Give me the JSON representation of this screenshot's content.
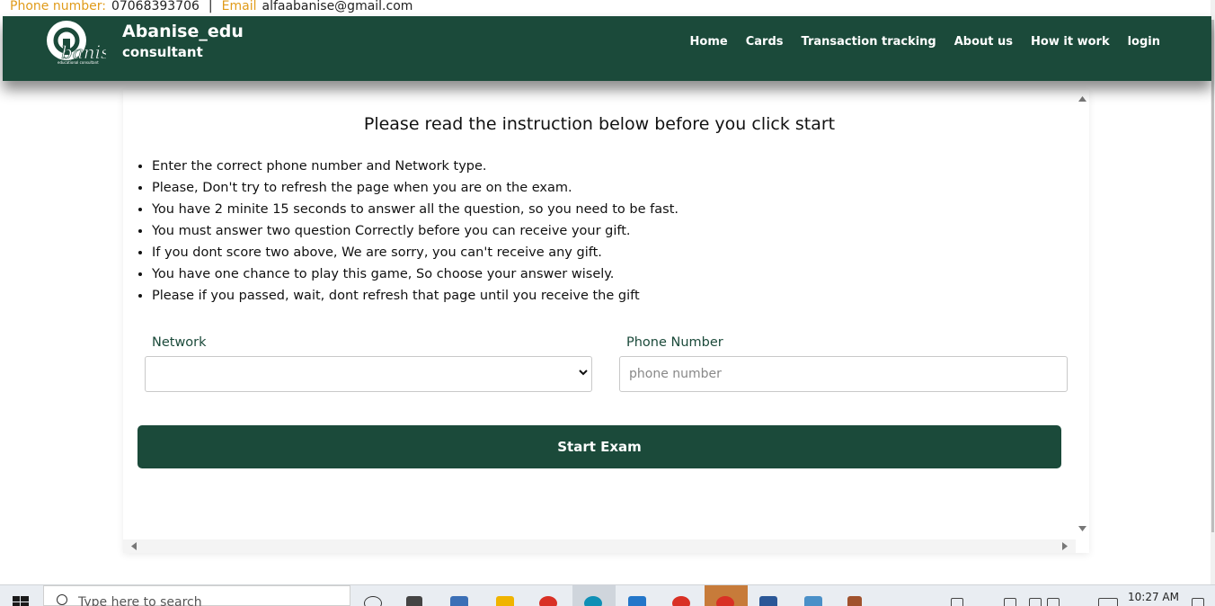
{
  "contact": {
    "phone_label": "Phone number:",
    "phone": "07068393706",
    "separator": "|",
    "email_label": "Email",
    "email": "alfaabanise@gmail.com"
  },
  "brand": {
    "title": "Abanise_edu",
    "subtitle": "consultant",
    "logo_text": "banise",
    "logo_caption": "educational consultant"
  },
  "nav": {
    "items": [
      "Home",
      "Cards",
      "Transaction tracking",
      "About us",
      "How it work",
      "login"
    ]
  },
  "card": {
    "title": "Please read the instruction below before you click start",
    "instructions": [
      "Enter the correct phone number and Network type.",
      "Please, Don't try to refresh the page when you are on the exam.",
      "You have 2 minite 15 seconds to answer all the question, so you need to be fast.",
      "You must answer two question Correctly before you can receive your gift.",
      "If you dont score two above, We are sorry, you can't receive any gift.",
      "You have one chance to play this game, So choose your answer wisely.",
      "Please if you passed, wait, dont refresh that page until you receive the gift"
    ]
  },
  "form": {
    "network_label": "Network",
    "network_value": "",
    "phone_label": "Phone Number",
    "phone_placeholder": "phone number",
    "phone_value": "",
    "start_label": "Start Exam"
  },
  "taskbar": {
    "search_placeholder": "Type here to search",
    "time": "10:27 AM"
  },
  "colors": {
    "brand_green": "#1b4a3a",
    "contact_label": "#e09b1a"
  }
}
